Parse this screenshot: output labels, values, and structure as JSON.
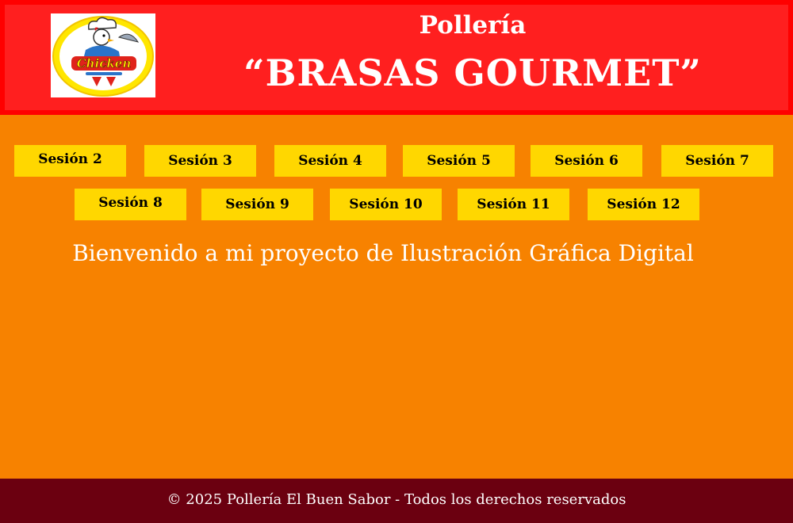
{
  "header": {
    "subtitle": "Pollería",
    "title": "“BRASAS GOURMET”",
    "logo_text": "Chicken",
    "brand_color": "#ff1f1f"
  },
  "nav": {
    "button_color": "#ffd700",
    "items": [
      {
        "label": "Sesión 2"
      },
      {
        "label": "Sesión 3"
      },
      {
        "label": "Sesión 4"
      },
      {
        "label": "Sesión 5"
      },
      {
        "label": "Sesión 6"
      },
      {
        "label": "Sesión 7"
      },
      {
        "label": "Sesión 8"
      },
      {
        "label": "Sesión 9"
      },
      {
        "label": "Sesión 10"
      },
      {
        "label": "Sesión 11"
      },
      {
        "label": "Sesión 12"
      }
    ]
  },
  "main": {
    "welcome": "Bienvenido a mi proyecto de Ilustración Gráfica Digital",
    "background_color": "#f78200"
  },
  "footer": {
    "text": "© 2025 Pollería El Buen Sabor - Todos los derechos reservados",
    "background_color": "#6b0010"
  }
}
